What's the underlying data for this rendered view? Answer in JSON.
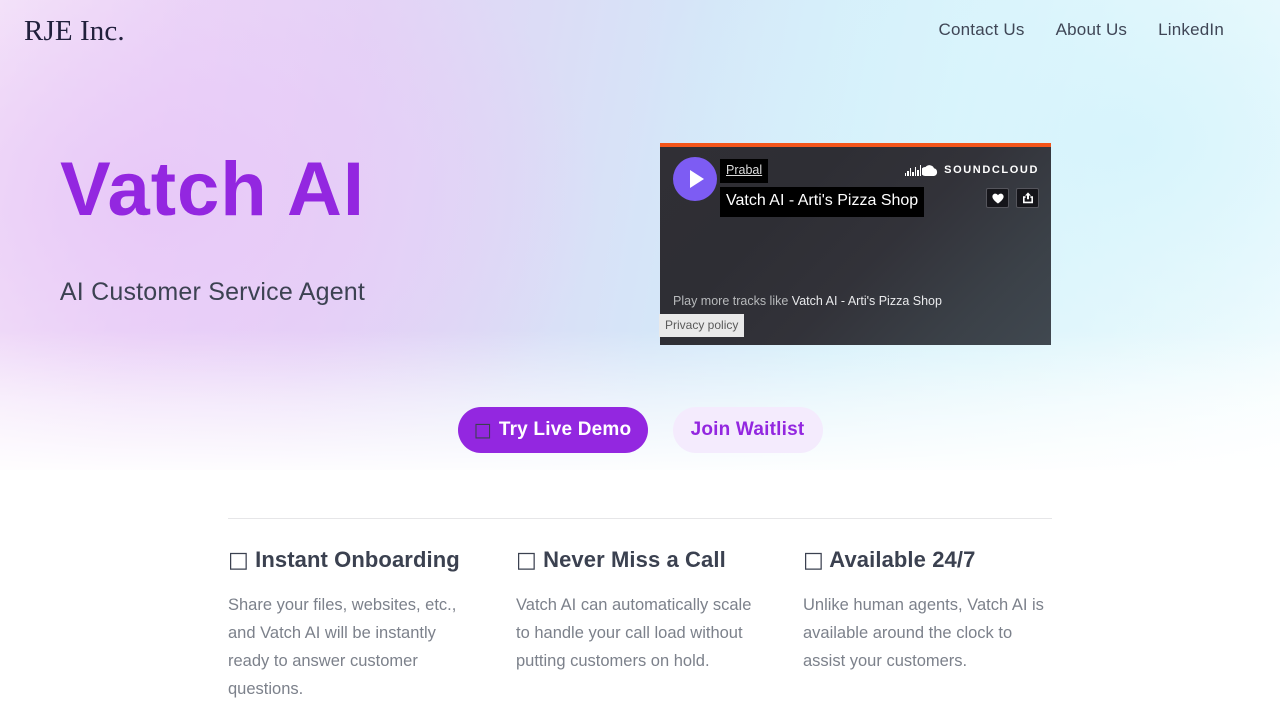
{
  "header": {
    "brand": "RJE Inc.",
    "nav": [
      {
        "label": "Contact Us"
      },
      {
        "label": "About Us"
      },
      {
        "label": "LinkedIn"
      }
    ]
  },
  "hero": {
    "title": "Vatch AI",
    "subtitle": "AI Customer Service Agent"
  },
  "player": {
    "provider": "SOUNDCLOUD",
    "artist": "Prabal",
    "track_title": "Vatch AI - Arti's Pizza Shop",
    "more_prefix": "Play more tracks like",
    "more_track": "Vatch AI - Arti's Pizza Shop",
    "privacy_label": "Privacy policy",
    "play_icon": "play-icon",
    "like_icon": "heart-icon",
    "share_icon": "share-icon",
    "accent_bar_color": "#f4551a",
    "play_button_color": "#7d5cf3"
  },
  "cta": {
    "primary_icon": "□",
    "primary_label": "Try Live Demo",
    "secondary_label": "Join Waitlist",
    "primary_color": "#9327e0",
    "secondary_color": "#f4ebfd"
  },
  "features": [
    {
      "icon": "□",
      "title": "Instant Onboarding",
      "description": "Share your files, websites, etc., and Vatch AI will be instantly ready to answer customer questions."
    },
    {
      "icon": "□",
      "title": "Never Miss a Call",
      "description": "Vatch AI can automatically scale to handle your call load without putting customers on hold."
    },
    {
      "icon": "□",
      "title": "Available 24/7",
      "description": "Unlike human agents, Vatch AI is available around the clock to assist your customers."
    }
  ]
}
